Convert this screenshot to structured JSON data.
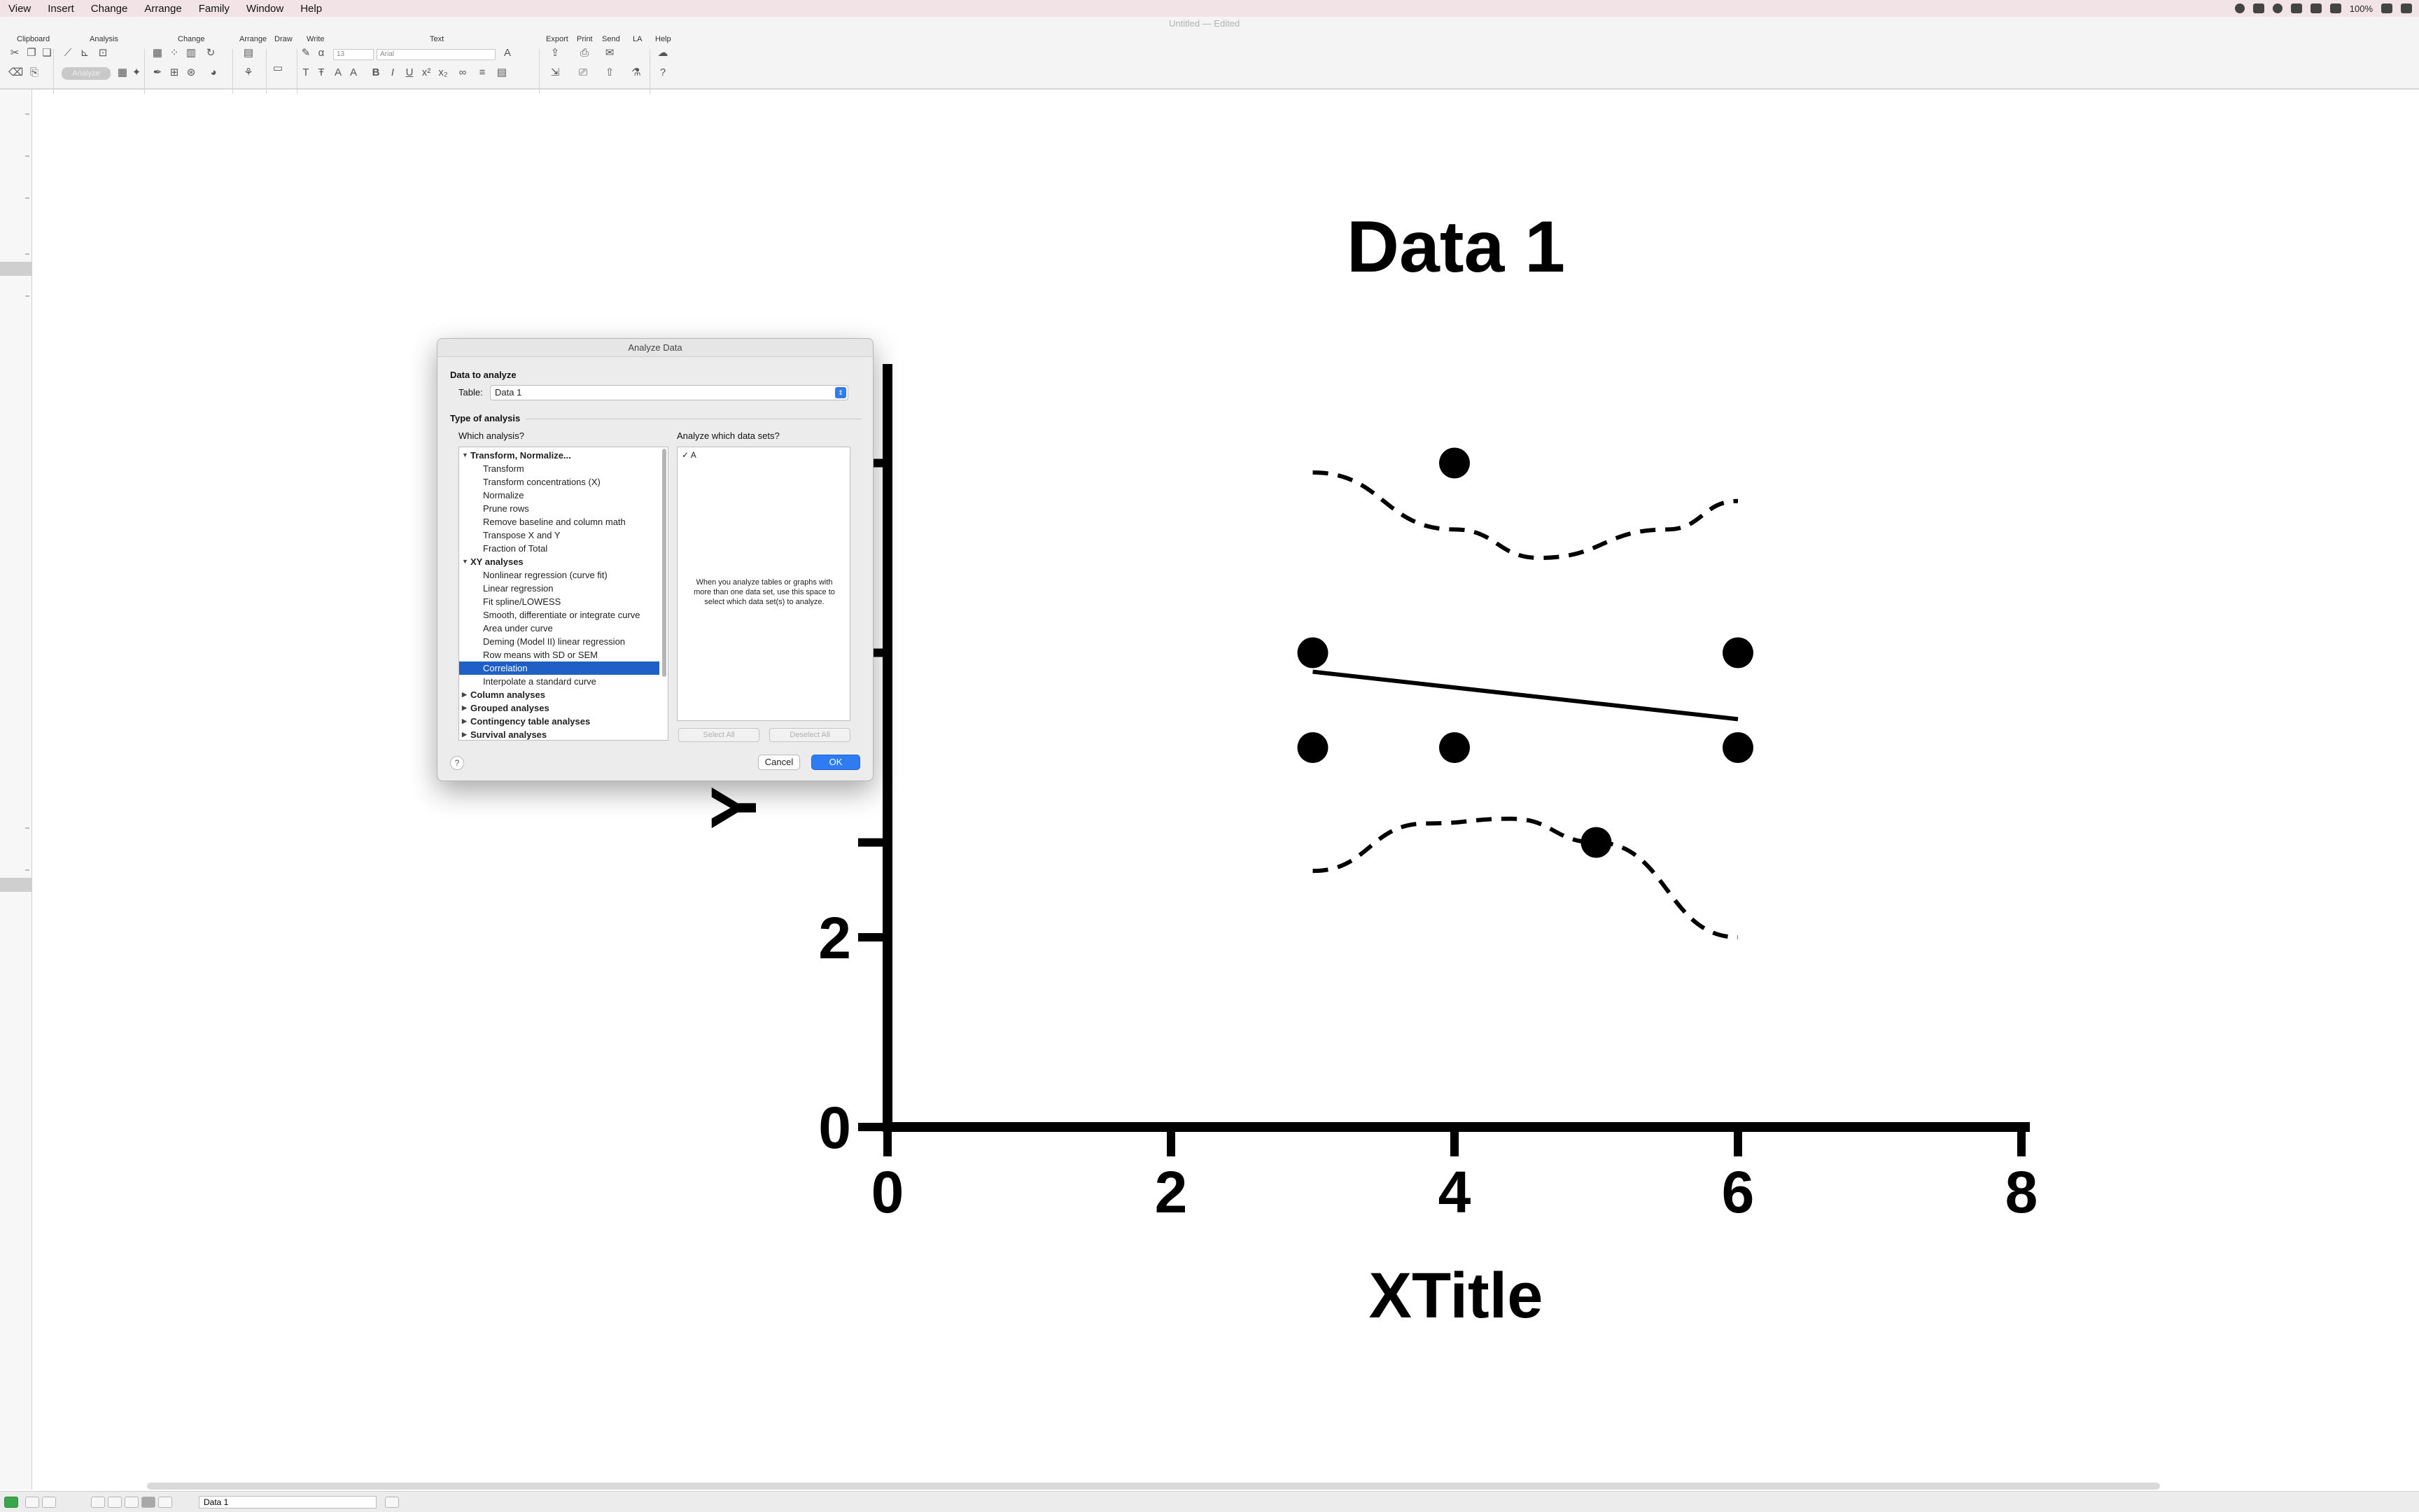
{
  "menubar": {
    "items": [
      "View",
      "Insert",
      "Change",
      "Arrange",
      "Family",
      "Window",
      "Help"
    ],
    "window_title": "Untitled — Edited",
    "battery": "100%"
  },
  "toolbar": {
    "sections": [
      "Clipboard",
      "Analysis",
      "Change",
      "Arrange",
      "Draw",
      "Write",
      "Text",
      "Export",
      "Print",
      "Send",
      "LA",
      "Help"
    ],
    "analyze_label": "Analyze",
    "font_size": "13",
    "font_name": "Arial"
  },
  "graph": {
    "title": "Data 1",
    "xlabel": "XTitle",
    "ylabel": "Y"
  },
  "chart_data": {
    "type": "scatter",
    "title": "Data 1",
    "xlabel": "XTitle",
    "ylabel": "Y",
    "xlim": [
      0,
      8
    ],
    "ylim": [
      0,
      8
    ],
    "x_ticks": [
      0,
      2,
      4,
      6,
      8
    ],
    "y_ticks": [
      0,
      2
    ],
    "grid": false,
    "series": [
      {
        "points": [
          [
            3,
            5
          ],
          [
            3,
            4
          ],
          [
            4,
            7
          ],
          [
            4,
            4
          ],
          [
            5,
            3
          ],
          [
            6,
            5
          ],
          [
            6,
            4
          ]
        ]
      }
    ],
    "fit_line": {
      "x": [
        3,
        6
      ],
      "y": [
        4.8,
        4.3
      ]
    },
    "confidence_bands": {
      "upper": [
        [
          3,
          6.9
        ],
        [
          4,
          6.3
        ],
        [
          4.6,
          6.0
        ],
        [
          5.5,
          6.3
        ],
        [
          6,
          6.6
        ]
      ],
      "lower": [
        [
          3,
          2.7
        ],
        [
          3.8,
          3.2
        ],
        [
          4.4,
          3.25
        ],
        [
          5,
          3.0
        ],
        [
          6,
          2.0
        ]
      ]
    }
  },
  "dialog": {
    "title": "Analyze Data",
    "data_to_analyze_label": "Data to analyze",
    "table_label": "Table:",
    "table_value": "Data 1",
    "type_of_analysis_label": "Type of analysis",
    "which_analysis_label": "Which analysis?",
    "which_datasets_label": "Analyze which data sets?",
    "tree": [
      {
        "kind": "group",
        "expanded": true,
        "label": "Transform, Normalize..."
      },
      {
        "kind": "item",
        "label": "Transform"
      },
      {
        "kind": "item",
        "label": "Transform concentrations (X)"
      },
      {
        "kind": "item",
        "label": "Normalize"
      },
      {
        "kind": "item",
        "label": "Prune rows"
      },
      {
        "kind": "item",
        "label": "Remove baseline and column math"
      },
      {
        "kind": "item",
        "label": "Transpose X and Y"
      },
      {
        "kind": "item",
        "label": "Fraction of Total"
      },
      {
        "kind": "group",
        "expanded": true,
        "label": "XY analyses"
      },
      {
        "kind": "item",
        "label": "Nonlinear regression (curve fit)"
      },
      {
        "kind": "item",
        "label": "Linear regression"
      },
      {
        "kind": "item",
        "label": "Fit spline/LOWESS"
      },
      {
        "kind": "item",
        "label": "Smooth, differentiate or integrate curve"
      },
      {
        "kind": "item",
        "label": "Area under curve"
      },
      {
        "kind": "item",
        "label": "Deming (Model II) linear regression"
      },
      {
        "kind": "item",
        "label": "Row means with SD or SEM"
      },
      {
        "kind": "item",
        "label": "Correlation",
        "selected": true
      },
      {
        "kind": "item",
        "label": "Interpolate a standard curve"
      },
      {
        "kind": "group",
        "expanded": false,
        "label": "Column analyses"
      },
      {
        "kind": "group",
        "expanded": false,
        "label": "Grouped analyses"
      },
      {
        "kind": "group",
        "expanded": false,
        "label": "Contingency table analyses"
      },
      {
        "kind": "group",
        "expanded": false,
        "label": "Survival analyses"
      }
    ],
    "datasets": [
      "A"
    ],
    "datasets_note": "When you analyze tables or graphs with more than one data set, use this space to select which data set(s) to analyze.",
    "select_all_label": "Select All",
    "deselect_all_label": "Deselect All",
    "help_label": "?",
    "cancel_label": "Cancel",
    "ok_label": "OK"
  },
  "bottombar": {
    "sheet_name": "Data 1"
  }
}
